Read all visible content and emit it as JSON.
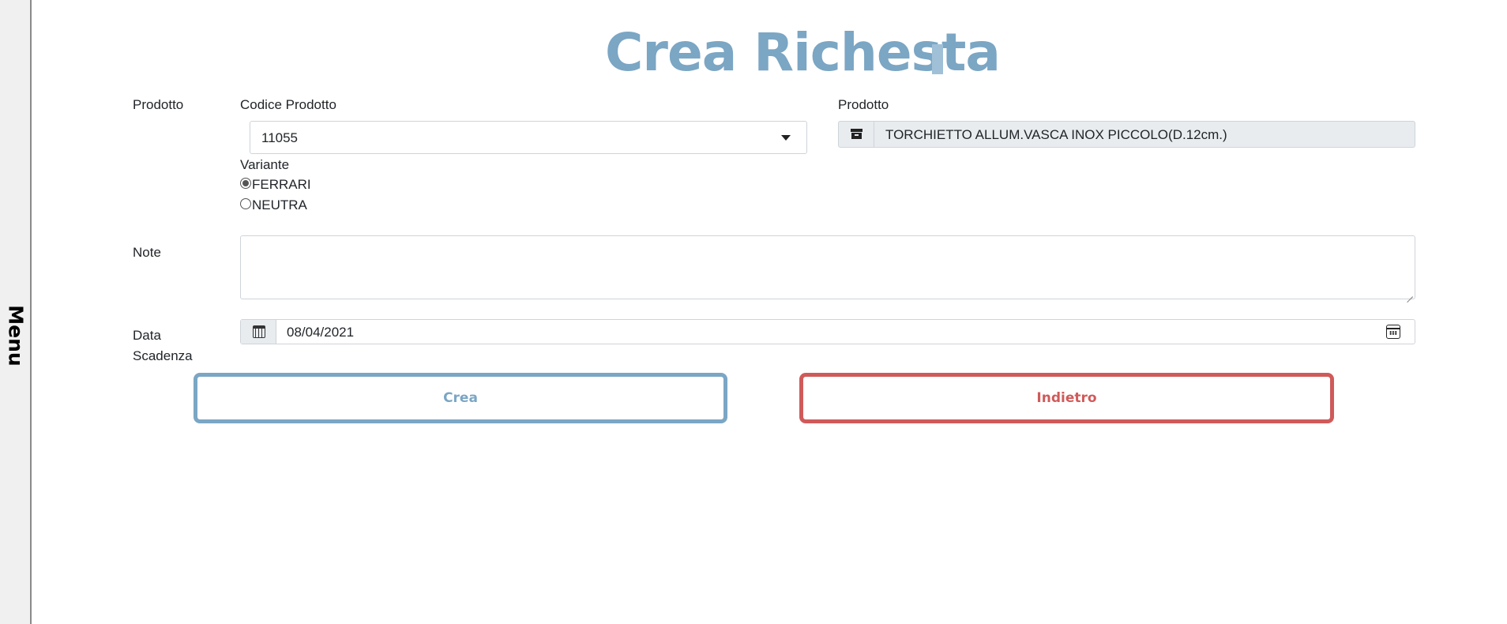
{
  "sidebar": {
    "menu_label": "Menu"
  },
  "header": {
    "title": "Crea Richesta"
  },
  "form": {
    "product_section_label": "Prodotto",
    "product_code": {
      "label": "Codice Prodotto",
      "value": "11055"
    },
    "product_name": {
      "label": "Prodotto",
      "value": "TORCHIETTO ALLUM.VASCA INOX PICCOLO(D.12cm.)",
      "icon": "archive-icon"
    },
    "variant": {
      "label": "Variante",
      "options": [
        {
          "label": "FERRARI",
          "checked": true
        },
        {
          "label": "NEUTRA",
          "checked": false
        }
      ]
    },
    "notes": {
      "label": "Note",
      "value": ""
    },
    "due_date": {
      "label_line1": "Data",
      "label_line2": "Scadenza",
      "value": "08/04/2021",
      "icon": "calendar-icon",
      "picker_icon": "calendar-picker-icon"
    }
  },
  "actions": {
    "create_label": "Crea",
    "back_label": "Indietro",
    "create_color": "#7ba6c4",
    "back_color": "#d05a5a"
  }
}
